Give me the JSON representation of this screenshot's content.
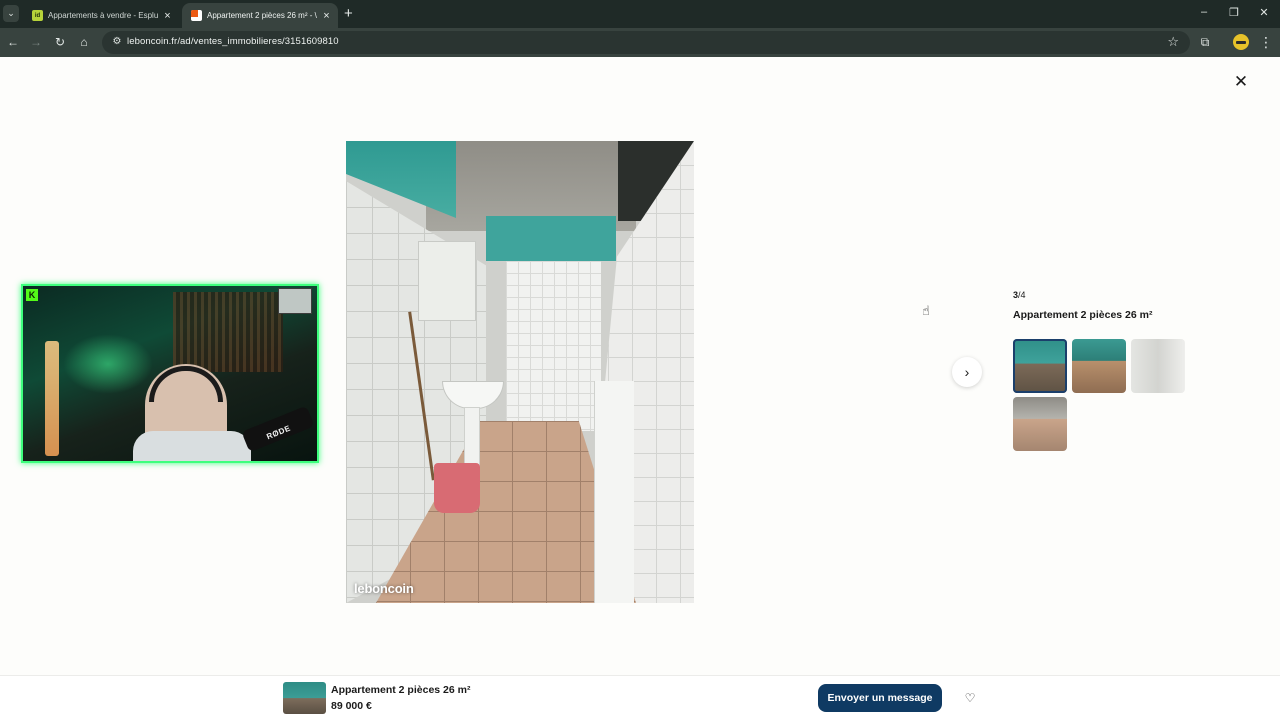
{
  "browser": {
    "tabs": [
      {
        "title": "Appartements à vendre - Esplu",
        "favicon": "idf-favicon",
        "active": false
      },
      {
        "title": "Appartement 2 pièces 26 m² - \\",
        "favicon": "leboncoin-favicon",
        "active": true
      }
    ],
    "url": "leboncoin.fr/ad/ventes_immobilieres/3151609810",
    "icons": {
      "tab_search": "chevron-down-icon",
      "new_tab": "plus-icon",
      "back": "arrow-left-icon",
      "forward": "arrow-right-icon",
      "reload": "reload-icon",
      "home": "home-icon",
      "site_info": "tune-icon",
      "bookmark": "star-icon",
      "extensions": "puzzle-icon",
      "menu": "more-vert-icon",
      "minimize": "minimize-icon",
      "restore": "restore-icon",
      "close": "close-icon"
    }
  },
  "gallery": {
    "watermark": "leboncoin",
    "counter_current": "3",
    "counter_total": "/4",
    "title": "Appartement 2 pièces 26 m²",
    "thumbnails": [
      {
        "name": "thumb-1",
        "selected": true
      },
      {
        "name": "thumb-2",
        "selected": false
      },
      {
        "name": "thumb-3",
        "selected": false
      },
      {
        "name": "thumb-4",
        "selected": false
      }
    ],
    "icons": {
      "close": "close-icon",
      "next": "chevron-right-icon"
    }
  },
  "webcam_overlay": {
    "mic_brand": "RØDE"
  },
  "bottom_bar": {
    "title": "Appartement 2 pièces 26 m²",
    "price": "89 000 €",
    "message_button": "Envoyer un message",
    "favorite_icon": "heart-icon"
  },
  "colors": {
    "primary_button": "#0f3a63",
    "webcam_border": "#3dff7d",
    "chrome_bg": "#1f2a27",
    "toolbar_bg": "#38433f"
  }
}
